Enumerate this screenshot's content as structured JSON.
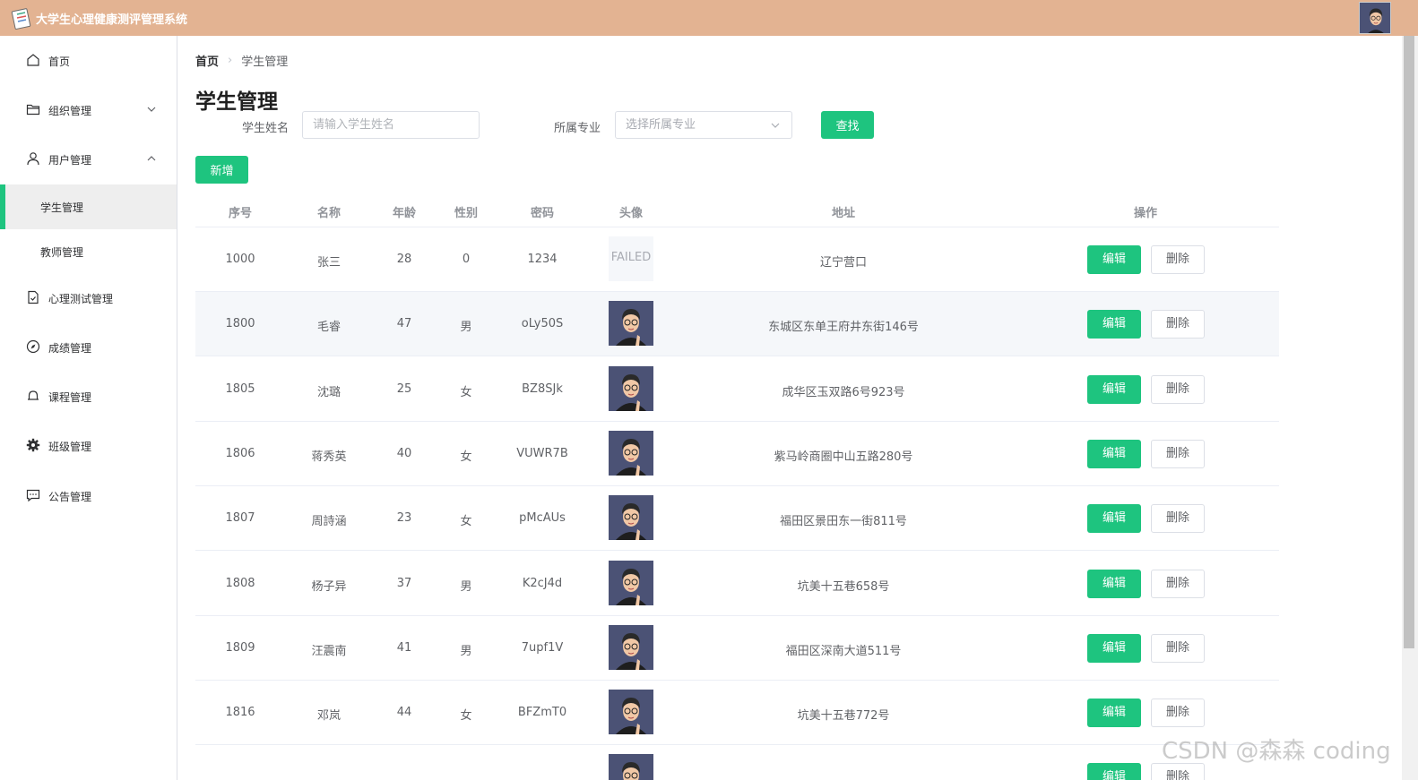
{
  "app": {
    "title": "大学生心理健康测评管理系统"
  },
  "sidebar": {
    "items": [
      {
        "label": "首页",
        "icon": "home-icon"
      },
      {
        "label": "组织管理",
        "icon": "folder-icon",
        "arrow": "chevron-down-icon"
      },
      {
        "label": "用户管理",
        "icon": "user-icon",
        "arrow": "chevron-up-icon"
      },
      {
        "label": "心理测试管理",
        "icon": "document-check-icon"
      },
      {
        "label": "成绩管理",
        "icon": "compass-icon"
      },
      {
        "label": "课程管理",
        "icon": "bell-icon"
      },
      {
        "label": "班级管理",
        "icon": "gear-icon"
      },
      {
        "label": "公告管理",
        "icon": "chat-icon"
      }
    ],
    "sub_items": [
      {
        "label": "学生管理",
        "active": true
      },
      {
        "label": "教师管理",
        "active": false
      }
    ]
  },
  "breadcrumb": {
    "home": "首页",
    "current": "学生管理"
  },
  "page": {
    "title": "学生管理"
  },
  "search": {
    "name_label": "学生姓名",
    "name_placeholder": "请输入学生姓名",
    "major_label": "所属专业",
    "major_placeholder": "选择所属专业",
    "search_button": "查找",
    "add_button": "新增"
  },
  "table": {
    "headers": [
      "序号",
      "名称",
      "年龄",
      "性别",
      "密码",
      "头像",
      "地址",
      "操作"
    ],
    "edit_label": "编辑",
    "delete_label": "删除",
    "failed_text": "FAILED",
    "rows": [
      {
        "id": "1000",
        "name": "张三",
        "age": "28",
        "gender": "0",
        "password": "1234",
        "address": "辽宁营口",
        "avatar_failed": true
      },
      {
        "id": "1800",
        "name": "毛睿",
        "age": "47",
        "gender": "男",
        "password": "oLy50S",
        "address": "东城区东单王府井东街146号",
        "avatar_failed": false
      },
      {
        "id": "1805",
        "name": "沈璐",
        "age": "25",
        "gender": "女",
        "password": "BZ8SJk",
        "address": "成华区玉双路6号923号",
        "avatar_failed": false
      },
      {
        "id": "1806",
        "name": "蒋秀英",
        "age": "40",
        "gender": "女",
        "password": "VUWR7B",
        "address": "紫马岭商圈中山五路280号",
        "avatar_failed": false
      },
      {
        "id": "1807",
        "name": "周詩涵",
        "age": "23",
        "gender": "女",
        "password": "pMcAUs",
        "address": "福田区景田东一街811号",
        "avatar_failed": false
      },
      {
        "id": "1808",
        "name": "杨子异",
        "age": "37",
        "gender": "男",
        "password": "K2cJ4d",
        "address": "坑美十五巷658号",
        "avatar_failed": false
      },
      {
        "id": "1809",
        "name": "汪震南",
        "age": "41",
        "gender": "男",
        "password": "7upf1V",
        "address": "福田区深南大道511号",
        "avatar_failed": false
      },
      {
        "id": "1816",
        "name": "邓岚",
        "age": "44",
        "gender": "女",
        "password": "BFZmT0",
        "address": "坑美十五巷772号",
        "avatar_failed": false
      },
      {
        "id": "",
        "name": "",
        "age": "",
        "gender": "",
        "password": "",
        "address": "",
        "avatar_failed": false
      }
    ]
  },
  "watermark": "CSDN @森森 coding",
  "colors": {
    "topbar": "#e3b392",
    "accent": "#1ec47f"
  }
}
